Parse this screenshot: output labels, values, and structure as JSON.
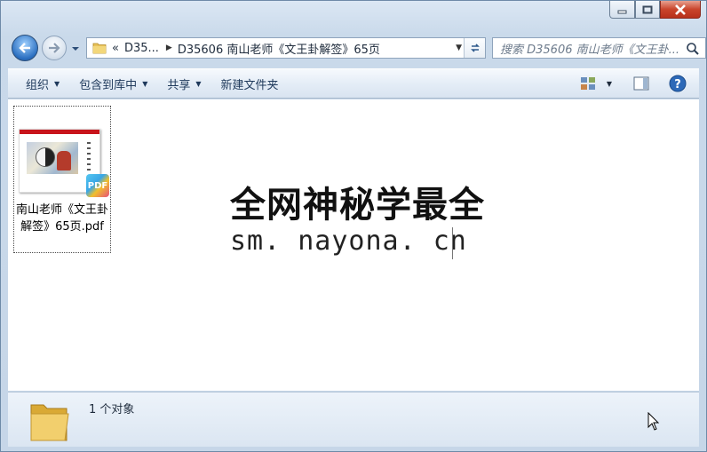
{
  "address": {
    "back_chevrons": "«",
    "crumb_parent": "D35...",
    "crumb_current": "D35606 南山老师《文王卦解签》65页"
  },
  "search": {
    "placeholder": "搜索 D35606 南山老师《文王卦..."
  },
  "toolbar": {
    "organize": "组织",
    "include_library": "包含到库中",
    "share": "共享",
    "new_folder": "新建文件夹"
  },
  "file": {
    "name": "南山老师《文王卦解签》65页.pdf",
    "badge": "PDF"
  },
  "watermark": {
    "line1": "全网神秘学最全",
    "line2": "sm. nayona. cn"
  },
  "details": {
    "count": "1 个对象"
  },
  "colors": {
    "accent": "#1e395b",
    "selection_border": "#4a4a4a",
    "close": "#c9452c"
  }
}
